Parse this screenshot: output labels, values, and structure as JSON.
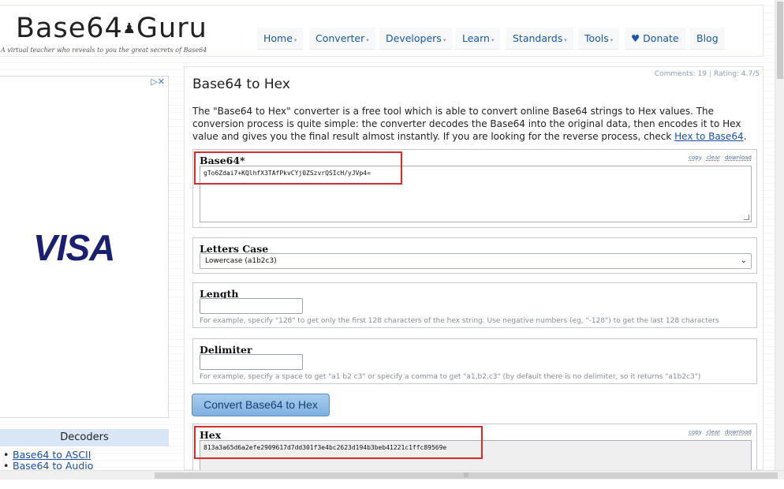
{
  "header": {
    "logo_text": "Base64.Guru",
    "logo_part1": "Base64",
    "logo_part2": "Guru",
    "logo_mark": "♟",
    "tagline": "A virtual teacher who reveals to you the great secrets of Base64",
    "nav": [
      {
        "label": "Home",
        "has_caret": true
      },
      {
        "label": "Converter",
        "has_caret": true
      },
      {
        "label": "Developers",
        "has_caret": true
      },
      {
        "label": "Learn",
        "has_caret": true
      },
      {
        "label": "Standards",
        "has_caret": true
      },
      {
        "label": "Tools",
        "has_caret": true
      },
      {
        "label": "♥ Donate",
        "has_caret": false
      },
      {
        "label": "Blog",
        "has_caret": false
      }
    ]
  },
  "ad": {
    "close_label": "▷✕",
    "brand": "VISA"
  },
  "sidebar": {
    "heading": "Decoders",
    "items": [
      "Base64 to ASCII",
      "Base64 to Audio"
    ]
  },
  "main": {
    "meta_comments": "Comments: 19",
    "meta_rating": "Rating: 4.7/5",
    "title": "Base64 to Hex",
    "intro_text": "The \"Base64 to Hex\" converter is a free tool which is able to convert online Base64 strings to Hex values. The conversion process is quite simple: the converter decodes the Base64 into the original data, then encodes it to Hex value and gives you the final result almost instantly. If you are looking for the reverse process, check ",
    "intro_link": "Hex to Base64",
    "intro_end": ".",
    "base64_panel": {
      "label": "Base64*",
      "value": "gTo6Zdai7+KQlhfX3TAfPkvCYj0ZSzvrQSIcH/yJVp4=",
      "links": [
        "copy",
        "clear",
        "download"
      ]
    },
    "letters_case": {
      "label": "Letters Case",
      "selected": "Lowercase (a1b2c3)"
    },
    "length": {
      "label": "Length",
      "value": "",
      "hint": "For example, specify \"128\" to get only the first 128 characters of the hex string. Use negative numbers (eg, \"-128\") to get the last 128 characters"
    },
    "delimiter": {
      "label": "Delimiter",
      "value": "",
      "hint": "For example, specify a space to get \"a1 b2 c3\" or specify a comma to get \"a1,b2,c3\" (by default there is no delimiter, so it returns \"a1b2c3\")"
    },
    "convert_button": "Convert Base64 to Hex",
    "hex_panel": {
      "label": "Hex",
      "value": "813a3a65d6a2efe2909617d7dd301f3e4bc2623d194b3beb41221c1ffc89569e",
      "links": [
        "copy",
        "clear",
        "download"
      ]
    }
  },
  "colors": {
    "highlight": "#d92b2b",
    "link": "#1a4fb0",
    "button": "#7eb0df",
    "visa": "#1a1f71"
  }
}
